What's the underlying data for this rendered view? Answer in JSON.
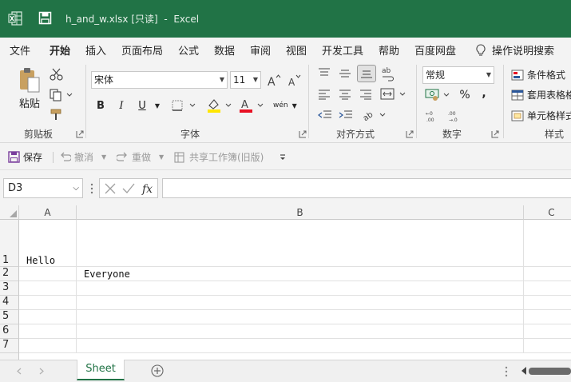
{
  "titlebar": {
    "filename": "h_and_w.xlsx",
    "readonly": "[只读]",
    "separator": "-",
    "app": "Excel"
  },
  "tabs": [
    {
      "label": "文件"
    },
    {
      "label": "开始"
    },
    {
      "label": "插入"
    },
    {
      "label": "页面布局"
    },
    {
      "label": "公式"
    },
    {
      "label": "数据"
    },
    {
      "label": "审阅"
    },
    {
      "label": "视图"
    },
    {
      "label": "开发工具"
    },
    {
      "label": "帮助"
    },
    {
      "label": "百度网盘"
    },
    {
      "label": "操作说明搜索"
    }
  ],
  "ribbon": {
    "clipboard": {
      "paste": "粘贴",
      "group": "剪贴板"
    },
    "font": {
      "name": "宋体",
      "size": "11",
      "group": "字体",
      "bold": "B",
      "italic": "I",
      "underline": "U",
      "phonetic": "wén",
      "color_char": "A"
    },
    "alignment": {
      "group": "对齐方式"
    },
    "number": {
      "format": "常规",
      "group": "数字",
      "percent": "%",
      "comma": ","
    },
    "styles": {
      "group": "样式",
      "conditional": "条件格式",
      "table": "套用表格格",
      "cell": "单元格样式"
    },
    "colors": {
      "highlight": "#ffe600",
      "font_color": "#e81123"
    }
  },
  "qat": {
    "save": "保存",
    "undo": "撤消",
    "redo": "重做",
    "share": "共享工作簿(旧版)"
  },
  "namebox": {
    "value": "D3"
  },
  "grid": {
    "columns": [
      "A",
      "B",
      "C"
    ],
    "rows": [
      "1",
      "2",
      "3",
      "4",
      "5",
      "6",
      "7"
    ],
    "cells": {
      "A1": "Hello",
      "B2": "Everyone"
    }
  },
  "sheets": [
    {
      "name": "Sheet"
    }
  ],
  "accent": "#217346"
}
